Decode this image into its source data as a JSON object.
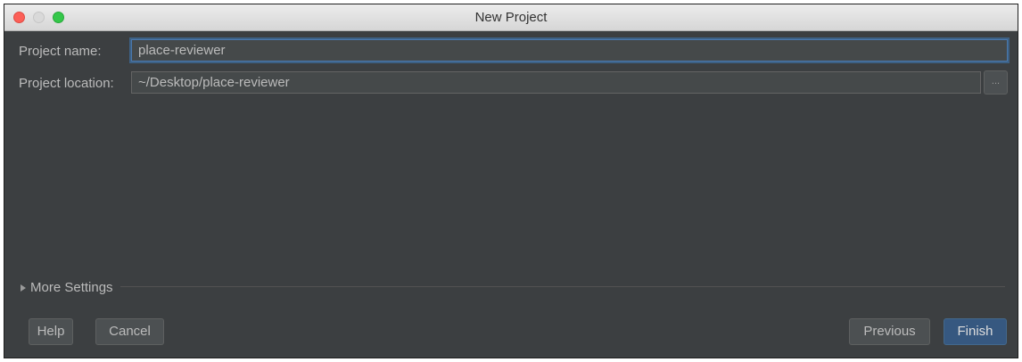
{
  "window": {
    "title": "New Project"
  },
  "form": {
    "project_name_label": "Project name:",
    "project_name_value": "place-reviewer",
    "project_location_label": "Project location:",
    "project_location_value": "~/Desktop/place-reviewer",
    "browse_label": "..."
  },
  "more_settings": {
    "label": "More Settings",
    "expanded": false
  },
  "buttons": {
    "help": "Help",
    "cancel": "Cancel",
    "previous": "Previous",
    "finish": "Finish"
  },
  "colors": {
    "background": "#3c3f41",
    "field_background": "#45494a",
    "focus_ring": "#4a78ad",
    "default_button": "#365880"
  },
  "icons": [
    "close-icon",
    "minimize-icon",
    "zoom-icon",
    "disclosure-triangle-icon",
    "ellipsis-icon"
  ]
}
